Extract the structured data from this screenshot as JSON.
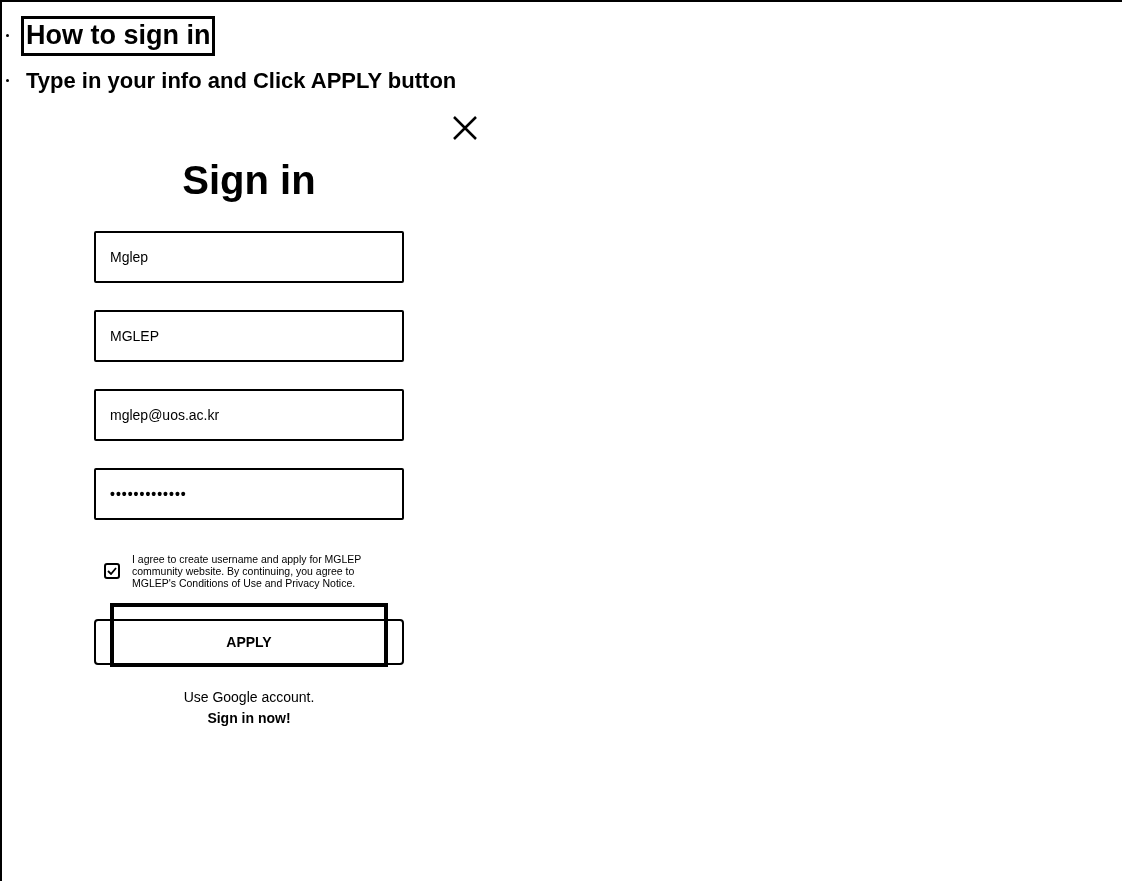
{
  "instructions": [
    {
      "text": "How to sign in",
      "highlighted": true
    },
    {
      "text": "Type in your info and Click APPLY button",
      "highlighted": false
    }
  ],
  "dialog": {
    "title": "Sign in",
    "fields": [
      {
        "kind": "text",
        "value": "Mglep"
      },
      {
        "kind": "text",
        "value": "MGLEP"
      },
      {
        "kind": "text",
        "value": "mglep@uos.ac.kr"
      },
      {
        "kind": "password",
        "value": "•••••••••••••"
      }
    ],
    "agreement": {
      "checked": true,
      "text": "I agree to create username and apply for MGLEP community website. By continuing, you agree to MGLEP's Conditions of Use and Privacy Notice."
    },
    "apply_button": {
      "label": "APPLY",
      "highlighted": true
    },
    "google_note": "Use Google account.",
    "google_link": "Sign in now!"
  }
}
